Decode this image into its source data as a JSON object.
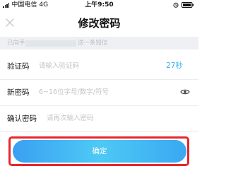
{
  "status_bar": {
    "carrier": "中国电信",
    "network": "4G",
    "time": "上午9:50"
  },
  "header": {
    "title": "修改密码"
  },
  "notice": {
    "prefix": "已向手",
    "suffix": "送一条短信"
  },
  "form": {
    "code": {
      "label": "验证码",
      "placeholder": "请输入验证码",
      "value": "",
      "countdown": "27秒"
    },
    "new_password": {
      "label": "新密码",
      "placeholder": "6~16位字母/数字/符号",
      "value": ""
    },
    "confirm_password": {
      "label": "确认密码",
      "placeholder": "请再次输入密码",
      "value": ""
    }
  },
  "confirm_button": {
    "label": "确定"
  },
  "colors": {
    "accent": "#3aaef0",
    "highlight_border": "#e8262c",
    "notice_bg": "#eef0f4"
  },
  "icons": {
    "close": "close-icon",
    "eye": "eye-icon",
    "alarm": "alarm-icon",
    "battery": "battery-icon",
    "signal": "signal-icon"
  }
}
